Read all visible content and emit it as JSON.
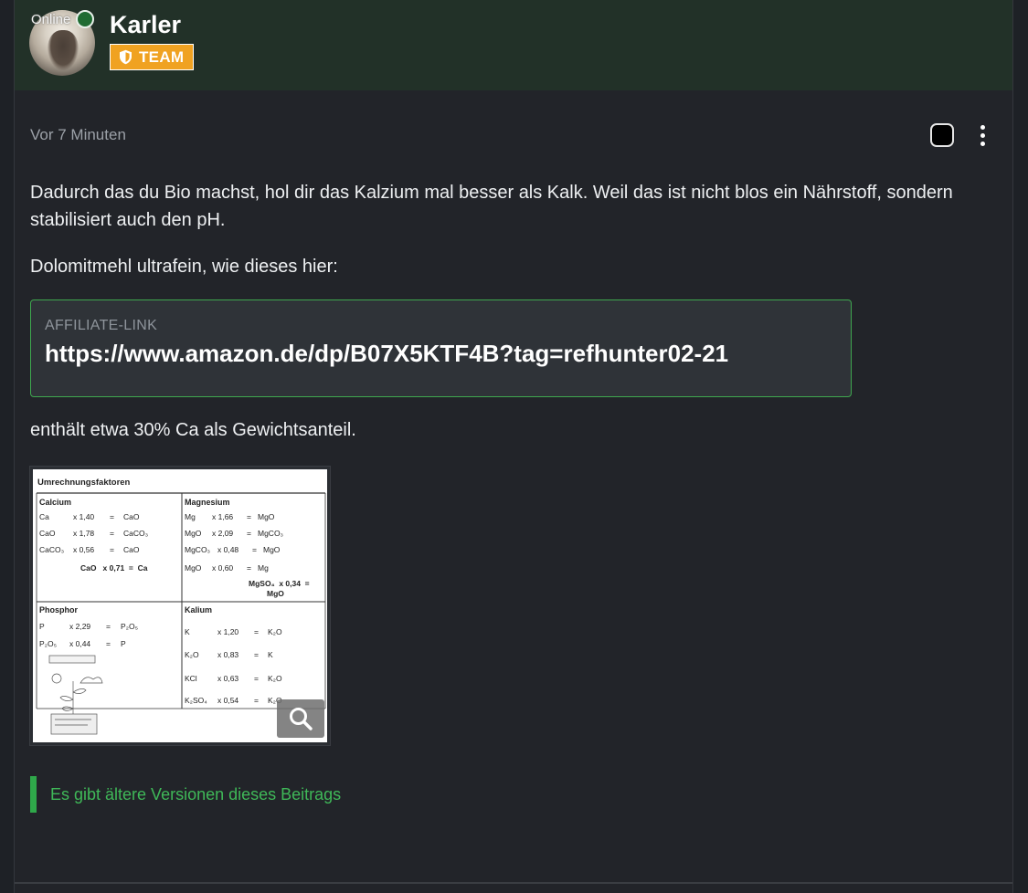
{
  "header": {
    "online_label": "Online",
    "username": "Karler",
    "badge_label": "TEAM"
  },
  "post": {
    "timestamp": "Vor 7 Minuten",
    "paragraph1": "Dadurch das du Bio machst, hol dir das Kalzium mal besser als Kalk. Weil das ist nicht blos ein Nährstoff, sondern stabilisiert auch den pH.",
    "paragraph2": "Dolomitmehl ultrafein, wie dieses hier:",
    "affiliate": {
      "label": "AFFILIATE-LINK",
      "url": "https://www.amazon.de/dp/B07X5KTF4B?tag=refhunter02-21"
    },
    "paragraph3": "enthält etwa 30% Ca als Gewichtsanteil.",
    "versions_link": "Es gibt ältere Versionen dieses Beitrags"
  },
  "image": {
    "title": "Umrechnungsfaktoren",
    "calcium": {
      "heading": "Calcium",
      "rows": [
        [
          "Ca",
          "x 1,40",
          "=",
          "CaO"
        ],
        [
          "CaO",
          "x 1,78",
          "=",
          "CaCO₃"
        ],
        [
          "CaCO₃",
          "x 0,56",
          "=",
          "CaO"
        ]
      ],
      "bold_row": "CaO   x 0,71  =  Ca"
    },
    "magnesium": {
      "heading": "Magnesium",
      "rows": [
        [
          "Mg",
          "x 1,66",
          "=",
          "MgO"
        ],
        [
          "MgO",
          "x 2,09",
          "=",
          "MgCO₃"
        ],
        [
          "MgCO₃",
          "x 0,48",
          "=",
          "MgO"
        ],
        [
          "MgO",
          "x 0,60",
          "=",
          "Mg"
        ]
      ],
      "bold_row_1": "MgSO₄  x 0,34  =",
      "bold_row_2": "MgO"
    },
    "phosphor": {
      "heading": "Phosphor",
      "rows": [
        [
          "P",
          "x 2,29",
          "=",
          "P₂O₅"
        ],
        [
          "P₂O₅",
          "x 0,44",
          "=",
          "P"
        ]
      ]
    },
    "kalium": {
      "heading": "Kalium",
      "rows": [
        [
          "K",
          "x 1,20",
          "=",
          "K₂O"
        ],
        [
          "K₂O",
          "x 0,83",
          "=",
          "K"
        ],
        [
          "KCl",
          "x 0,63",
          "=",
          "K₂O"
        ],
        [
          "K₂SO₄",
          "x 0,54",
          "=",
          "K₂O"
        ]
      ]
    }
  },
  "colors": {
    "header_bg": "#223128",
    "badge": "#f0a221",
    "accent_green": "#3fb858"
  }
}
